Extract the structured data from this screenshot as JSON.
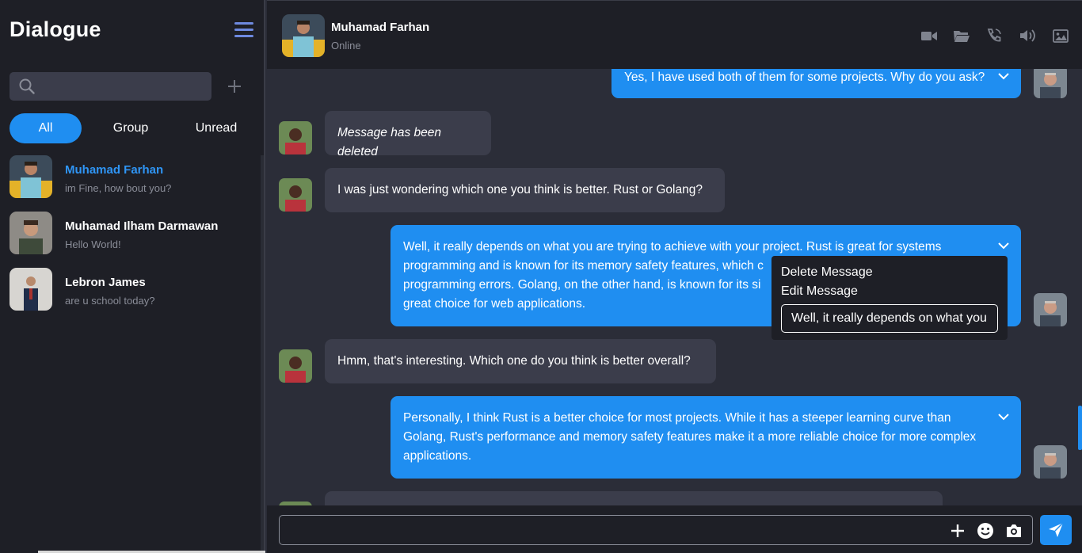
{
  "app": {
    "title": "Dialogue"
  },
  "sidebar": {
    "search": {
      "placeholder": ""
    },
    "tabs": [
      {
        "label": "All",
        "active": true
      },
      {
        "label": "Group",
        "active": false
      },
      {
        "label": "Unread",
        "active": false
      }
    ],
    "contacts": [
      {
        "name": "Muhamad Farhan",
        "preview": "im Fine, how bout you?",
        "current": true
      },
      {
        "name": "Muhamad Ilham Darmawan",
        "preview": "Hello World!",
        "current": false
      },
      {
        "name": "Lebron James",
        "preview": "are u school today?",
        "current": false
      }
    ]
  },
  "chat": {
    "header": {
      "name": "Muhamad Farhan",
      "status": "Online"
    },
    "messages": [
      {
        "direction": "out",
        "text": "Yes, I have used both of them for some projects. Why do you ask?"
      },
      {
        "direction": "in",
        "text": "Message has been deleted",
        "deleted": true
      },
      {
        "direction": "in",
        "text": "I was just wondering which one you think is better. Rust or Golang?"
      },
      {
        "direction": "out",
        "lines": [
          "Well, it really depends on what you are trying to achieve with your project. Rust is great for systems",
          "programming and is known for its memory safety features, which c",
          "programming errors. Golang, on the other hand, is known for its si",
          "great choice for web applications."
        ]
      },
      {
        "direction": "in",
        "text": "Hmm, that's interesting. Which one do you think is better overall?"
      },
      {
        "direction": "out",
        "lines": [
          "Personally, I think Rust is a better choice for most projects. While it has a steeper learning curve than",
          "Golang, Rust's performance and memory safety features make it a more reliable choice for more complex",
          "applications."
        ]
      }
    ],
    "context_menu": {
      "delete_label": "Delete Message",
      "edit_label": "Edit Message",
      "edit_value": "Well, it really depends on what you are trying to achieve with your project."
    },
    "composer": {
      "placeholder": ""
    }
  },
  "colors": {
    "accent": "#1f8ef1",
    "sidebar_bg": "#1e1f26",
    "chat_bg": "#2b2d38",
    "incoming_bubble": "#3b3d4b"
  },
  "icons": [
    "menu-icon",
    "search-icon",
    "plus-icon",
    "video-icon",
    "folder-icon",
    "phone-icon",
    "speaker-icon",
    "image-icon",
    "chevron-down-icon",
    "emoji-icon",
    "camera-icon",
    "send-icon"
  ]
}
